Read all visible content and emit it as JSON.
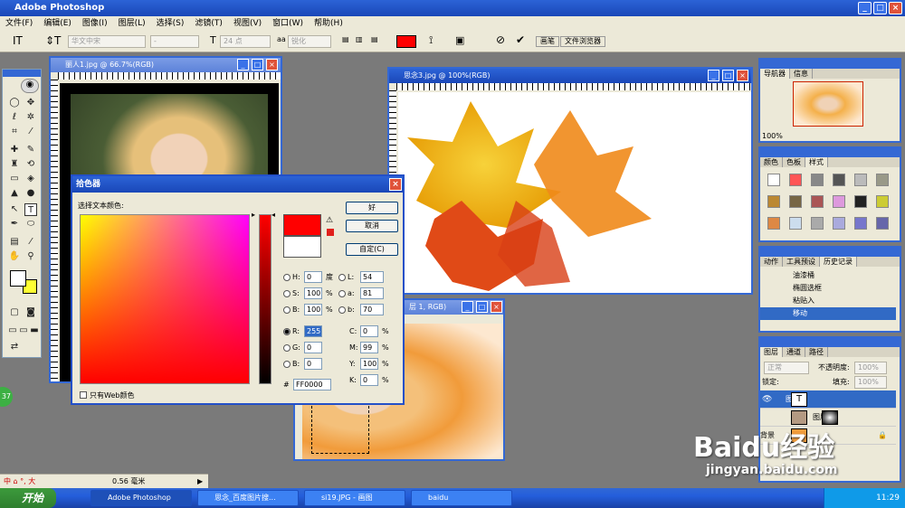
{
  "app": {
    "title": "Adobe Photoshop"
  },
  "menu": [
    "文件(F)",
    "编辑(E)",
    "图像(I)",
    "图层(L)",
    "选择(S)",
    "滤镜(T)",
    "视图(V)",
    "窗口(W)",
    "帮助(H)"
  ],
  "options": {
    "font_family": "华文中宋",
    "font_size": "24 点",
    "aa_label": "aa",
    "aa_mode": "锐化",
    "text_color": "#ff0000",
    "tabs": [
      "画笔",
      "文件浏览器"
    ]
  },
  "windows": {
    "doc1": {
      "title": "丽人1.jpg @ 66.7%(RGB)"
    },
    "doc2": {
      "title": "思念3.jpg @ 100%(RGB)"
    },
    "doc3": {
      "title": "层 1, RGB)"
    }
  },
  "picker": {
    "title": "拾色器",
    "prompt": "选择文本颜色:",
    "ok": "好",
    "cancel": "取消",
    "custom": "自定(C)",
    "fields": {
      "H": "0",
      "H_unit": "度",
      "S": "100",
      "B": "100",
      "L": "54",
      "a": "81",
      "b": "70",
      "R": "255",
      "G": "0",
      "Bv": "0",
      "C": "0",
      "M": "99",
      "Y": "100",
      "K": "0",
      "hex": "FF0000"
    },
    "labels": {
      "H": "H:",
      "S": "S:",
      "B": "B:",
      "L": "L:",
      "a": "a:",
      "b": "b:",
      "R": "R:",
      "G": "G:",
      "Bv": "B:",
      "C": "C:",
      "M": "M:",
      "Y": "Y:",
      "K": "K:",
      "hash": "#",
      "pct": "%"
    },
    "web_only": "只有Web颜色",
    "color": "#ff0000"
  },
  "navigator": {
    "tabs": [
      "导航器",
      "信息"
    ],
    "zoom": "100%"
  },
  "swatches": {
    "tabs": [
      "颜色",
      "色板",
      "样式"
    ]
  },
  "history": {
    "tabs": [
      "动作",
      "工具预设",
      "历史记录"
    ],
    "items": [
      "油漆桶",
      "椭圆选框",
      "粘贴入",
      "移动"
    ]
  },
  "layers": {
    "tabs": [
      "图层",
      "通道",
      "路径"
    ],
    "blend": "正常",
    "opacity_label": "不透明度:",
    "opacity": "100%",
    "lock_label": "锁定:",
    "fill_label": "填充:",
    "fill": "100%",
    "items": [
      "图层 2",
      "图层 1",
      "背景"
    ]
  },
  "status": {
    "zoom": "0.56 毫米",
    "ime": "中 ⌂ °, 大"
  },
  "taskbar": {
    "start": "开始",
    "tasks": [
      "Adobe Photoshop",
      "思念_百度图片搜...",
      "si19.JPG - 画图",
      "baidu"
    ],
    "time": "11:29"
  },
  "watermark": {
    "brand": "Baidu经验",
    "url": "jingyan.baidu.com"
  },
  "badge": "37"
}
